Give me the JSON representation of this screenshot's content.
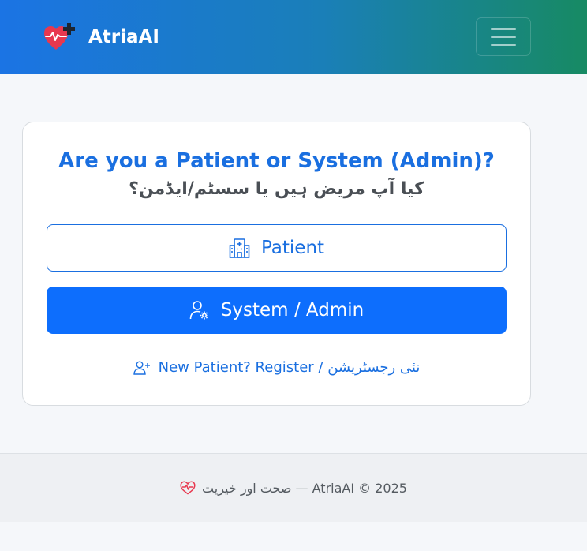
{
  "navbar": {
    "brand_name": "AtriaAI",
    "menu_toggle_label": "Toggle navigation"
  },
  "card": {
    "title_en": "Are you a Patient or System (Admin)?",
    "title_ur": "کیا آپ مریض ہیں یا سسٹم/ایڈمن؟",
    "patient_button": "Patient",
    "admin_button": "System / Admin",
    "register_link": "New Patient? Register / نئی رجسٹریشن"
  },
  "footer": {
    "text": "صحت اور خیریت — AtriaAI © 2025"
  },
  "colors": {
    "primary": "#0d6efd",
    "title_blue": "#1a6fe0",
    "heart_red": "#e8384f",
    "navbar_gradient_start": "#1b74e4",
    "navbar_gradient_end": "#178a63"
  },
  "icons": {
    "brand": "heart-pulse-plus-icon",
    "patient": "hospital-icon",
    "admin": "person-gear-icon",
    "register": "person-plus-icon",
    "footer": "heart-pulse-icon",
    "toggler": "hamburger-icon"
  }
}
